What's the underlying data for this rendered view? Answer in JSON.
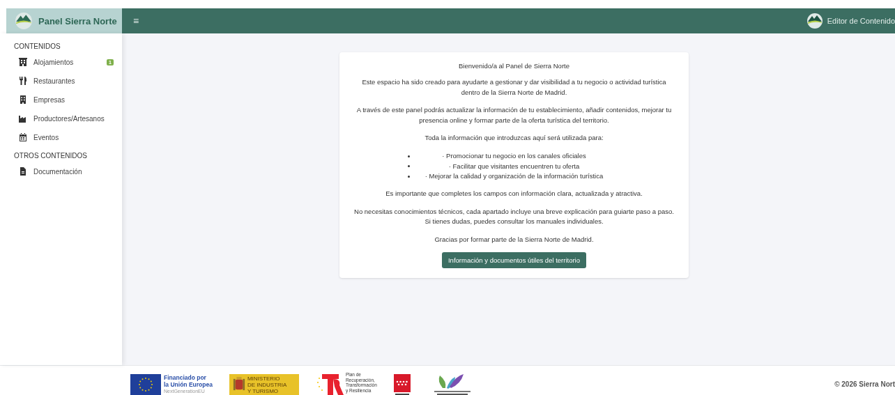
{
  "brand": {
    "title": "Panel Sierra Norte"
  },
  "topbar": {
    "menu_glyph": "≡",
    "user": "Editor de Contenido"
  },
  "sidebar": {
    "sections": [
      {
        "heading": "CONTENIDOS",
        "items": [
          {
            "label": "Alojamientos",
            "badge": "1"
          },
          {
            "label": "Restaurantes"
          },
          {
            "label": "Empresas"
          },
          {
            "label": "Productores/Artesanos"
          },
          {
            "label": "Eventos"
          }
        ]
      },
      {
        "heading": "OTROS CONTENIDOS",
        "items": [
          {
            "label": "Documentación"
          }
        ]
      }
    ]
  },
  "welcome": {
    "title": "Bienvenido/a al Panel de Sierra Norte",
    "paragraphs_before": [
      "Este espacio ha sido creado para ayudarte a gestionar y dar visibilidad a tu negocio o actividad turística dentro de la Sierra Norte de Madrid.",
      "A través de este panel podrás actualizar la información de tu establecimiento, añadir contenidos, mejorar tu presencia online y formar parte de la oferta turística del territorio.",
      "Toda la información que introduzcas aquí será utilizada para:"
    ],
    "bullets": [
      "· Promocionar tu negocio en los canales oficiales",
      "· Facilitar que visitantes encuentren tu oferta",
      "· Mejorar la calidad y organización de la información turística"
    ],
    "paragraphs_after": [
      [
        "Es importante que completes los campos con información clara, actualizada y atractiva."
      ],
      [
        "No necesitas conocimientos técnicos, cada apartado incluye una breve explicación para guiarte paso a paso.",
        "Si tienes dudas, puedes consultar los manuales individuales."
      ],
      [
        "Gracias por formar parte de la Sierra Norte de Madrid."
      ]
    ],
    "button": "Información y documentos útiles del territorio"
  },
  "footer": {
    "eu_logo": [
      "Financiado por",
      "la Unión Europea",
      "NextGenerationEU"
    ],
    "ministry_logo": [
      "MINISTERIO",
      "DE INDUSTRIA",
      "Y TURISMO"
    ],
    "plan_logo": [
      "Plan de",
      "Recuperación,",
      "Transformación",
      "y Resiliencia"
    ],
    "copyright": "© 2026 Sierra Nort"
  }
}
